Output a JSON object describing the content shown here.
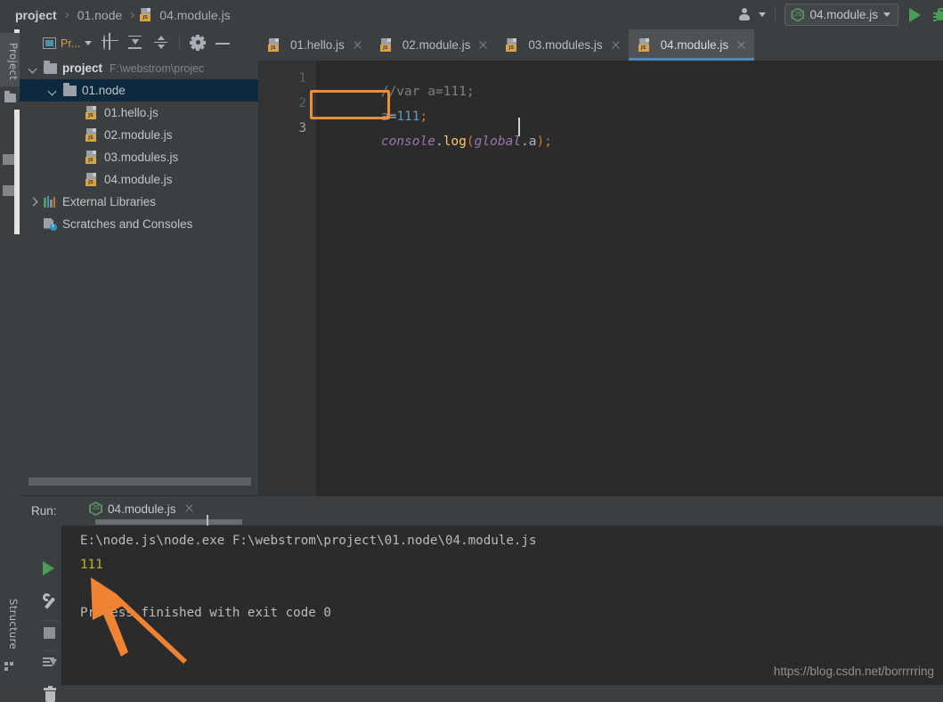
{
  "breadcrumb": {
    "items": [
      {
        "label": "project",
        "bold": true,
        "icon": null
      },
      {
        "label": "01.node",
        "bold": false,
        "icon": null
      },
      {
        "label": "04.module.js",
        "bold": false,
        "icon": "js-file-icon"
      }
    ],
    "separator": "›"
  },
  "topbar": {
    "people_icon": "people-icon",
    "run_config": {
      "icon": "nodejs-icon",
      "name": "04.module.js",
      "caret": "▾"
    },
    "run_button": "run-icon",
    "debug_button": "debug-bug-icon"
  },
  "left_sidebar": {
    "project_tab": "Project",
    "structure_tab": "Structure",
    "folder_icon": "folder-icon",
    "structure_icon": "structure-icon"
  },
  "project_panel": {
    "toolbar": {
      "view_label": "Pr...",
      "view_caret": "▾",
      "locate_icon": "crosshair-target-icon",
      "collapse_icon": "collapse-all-icon",
      "expand_icon": "expand-all-icon",
      "settings_icon": "gear-icon",
      "hide_icon": "minimize-icon"
    },
    "tree": [
      {
        "label": "project",
        "path": "F:\\webstrom\\projec",
        "type": "folder",
        "arrow": "down",
        "indent": 0,
        "selected": false,
        "bold": true
      },
      {
        "label": "01.node",
        "path": "",
        "type": "folder",
        "arrow": "down",
        "indent": 1,
        "selected": true,
        "bold": false
      },
      {
        "label": "01.hello.js",
        "path": "",
        "type": "js",
        "arrow": "none",
        "indent": 2,
        "selected": false,
        "bold": false
      },
      {
        "label": "02.module.js",
        "path": "",
        "type": "js",
        "arrow": "none",
        "indent": 2,
        "selected": false,
        "bold": false
      },
      {
        "label": "03.modules.js",
        "path": "",
        "type": "js",
        "arrow": "none",
        "indent": 2,
        "selected": false,
        "bold": false
      },
      {
        "label": "04.module.js",
        "path": "",
        "type": "js",
        "arrow": "none",
        "indent": 2,
        "selected": false,
        "bold": false
      },
      {
        "label": "External Libraries",
        "path": "",
        "type": "libs",
        "arrow": "right",
        "indent": 0,
        "selected": false,
        "bold": false
      },
      {
        "label": "Scratches and Consoles",
        "path": "",
        "type": "scratches",
        "arrow": "none",
        "indent": 0,
        "selected": false,
        "bold": false
      }
    ]
  },
  "editor": {
    "tabs": [
      {
        "label": "01.hello.js",
        "active": false
      },
      {
        "label": "02.module.js",
        "active": false
      },
      {
        "label": "03.modules.js",
        "active": false
      },
      {
        "label": "04.module.js",
        "active": true
      }
    ],
    "line_numbers": [
      "1",
      "2",
      "3"
    ],
    "code": {
      "line1": {
        "comment": "//var a=111;"
      },
      "line2": {
        "ident": "a",
        "op": "=",
        "num": "111",
        "semi": ";"
      },
      "line3": {
        "obj": "console",
        "dot1": ".",
        "fn": "log",
        "paren_open": "(",
        "arg": "global",
        "dot2": ".",
        "prop": "a",
        "paren_close": ")",
        "semi": ";"
      }
    },
    "highlight_color": "#eb8f34"
  },
  "run_panel": {
    "label": "Run:",
    "tab_name": "04.module.js",
    "tab_icon": "nodejs-icon",
    "close_icon": "close-icon",
    "tools": {
      "rerun": "run-icon",
      "settings": "wrench-icon",
      "stop": "stop-icon",
      "scroll": "scroll-to-end-icon",
      "clear": "trash-icon"
    },
    "console": {
      "command": "E:\\node.js\\node.exe F:\\webstrom\\project\\01.node\\04.module.js",
      "output": "111",
      "status": "Process finished with exit code 0"
    }
  },
  "watermark": "https://blog.csdn.net/borrrrring",
  "annotation": {
    "arrow_color": "#ef8333"
  }
}
